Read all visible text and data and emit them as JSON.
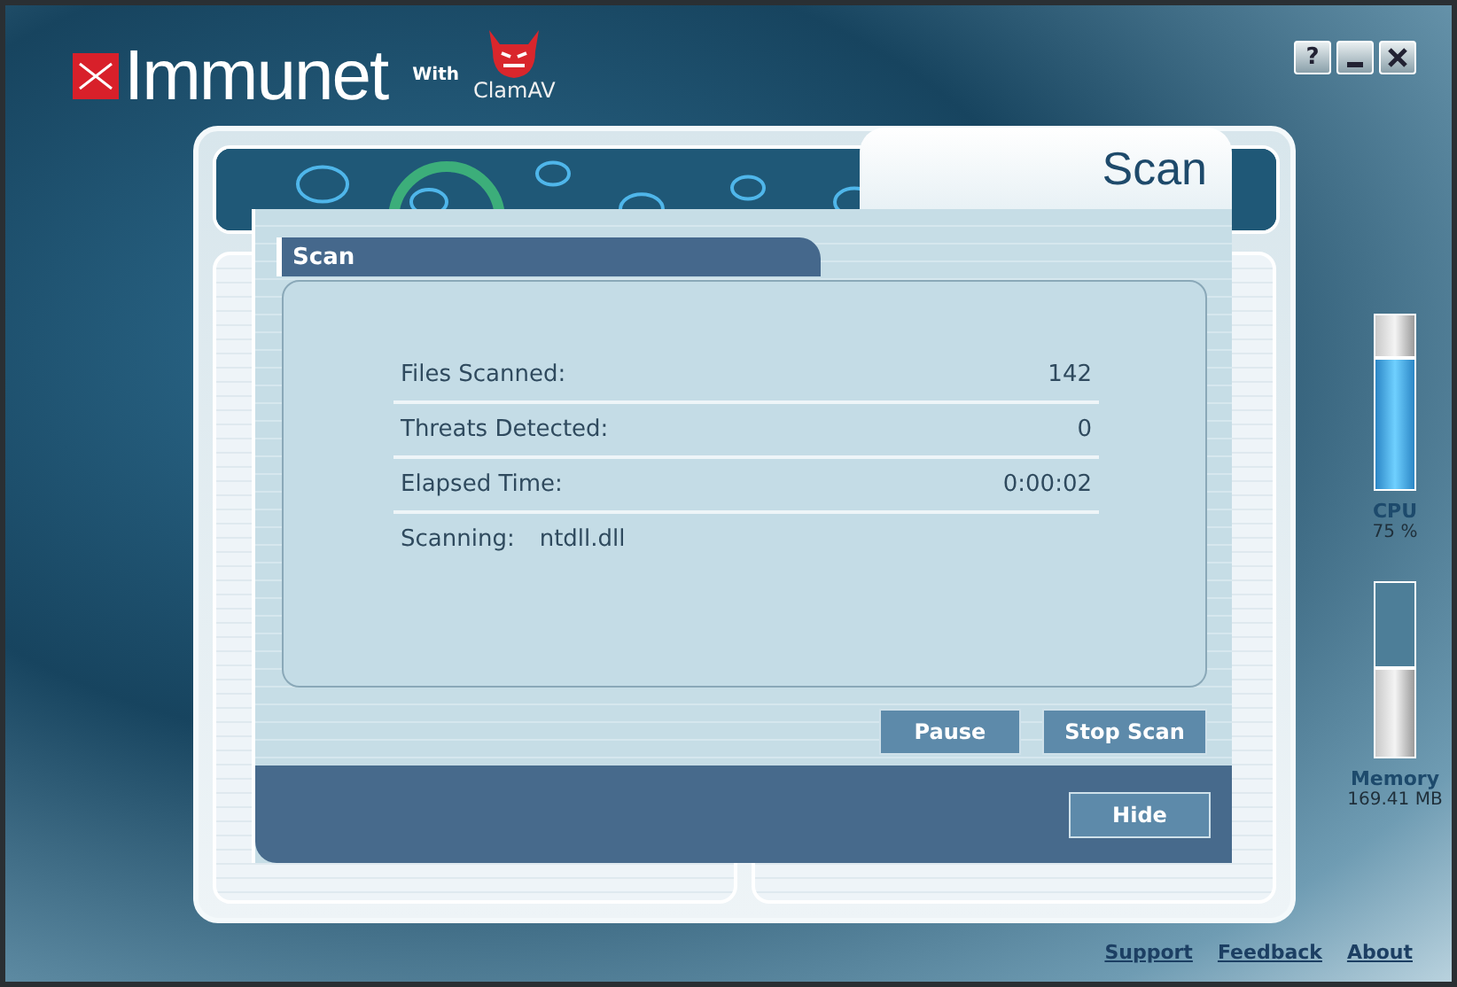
{
  "window": {
    "buttons": [
      {
        "kind": "help",
        "label": "?"
      },
      {
        "kind": "minimize"
      },
      {
        "kind": "close"
      }
    ]
  },
  "branding": {
    "product": "Immunet",
    "with": "With",
    "partner": "ClamAV"
  },
  "dialog": {
    "title": "Scan",
    "section": "Scan",
    "stats": [
      {
        "label": "Files Scanned:",
        "value": "142"
      },
      {
        "label": "Threats Detected:",
        "value": "0"
      },
      {
        "label": "Elapsed Time:",
        "value": "0:00:02"
      }
    ],
    "scanning": {
      "label": "Scanning:",
      "file": "ntdll.dll"
    },
    "buttons": [
      "Pause",
      "Stop Scan"
    ],
    "footer_button": "Hide"
  },
  "meters": [
    {
      "kind": "fill",
      "name": "CPU",
      "reading": "75 %",
      "level": 0.75
    },
    {
      "kind": "reserve",
      "name": "Memory",
      "reading": "169.41 MB",
      "level": 0.5
    }
  ],
  "links": [
    "Support",
    "Feedback",
    "About"
  ]
}
